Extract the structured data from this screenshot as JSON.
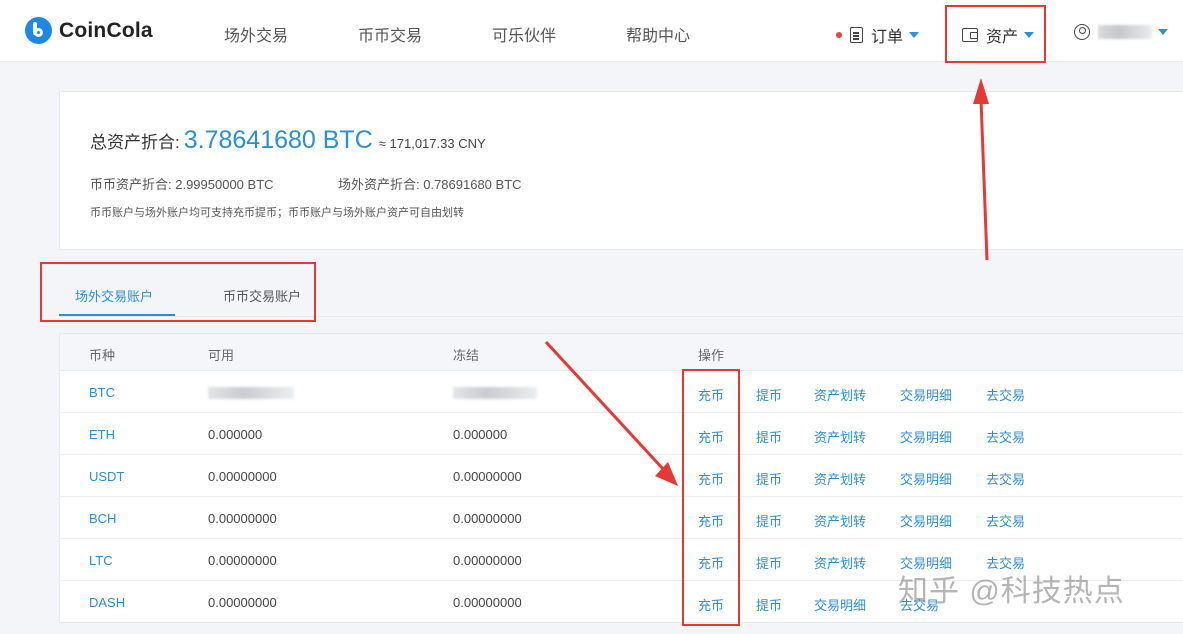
{
  "header": {
    "logo_text": "CoinCola",
    "nav": [
      "场外交易",
      "币币交易",
      "可乐伙伴",
      "帮助中心"
    ],
    "orders_label": "订单",
    "assets_label": "资产"
  },
  "summary": {
    "total_label": "总资产折合:",
    "total_value": "3.78641680 BTC",
    "total_cny": "≈ 171,017.33 CNY",
    "coin_assets": "币币资产折合: 2.99950000 BTC",
    "otc_assets": "场外资产折合: 0.78691680 BTC",
    "note": "币币账户与场外账户均可支持充币提币；币币账户与场外账户资产可自由划转"
  },
  "tabs": [
    "场外交易账户",
    "币币交易账户"
  ],
  "table": {
    "headers": [
      "币种",
      "可用",
      "冻结",
      "操作"
    ],
    "rows": [
      {
        "coin": "BTC",
        "available": "",
        "frozen": "",
        "actions": [
          "充币",
          "提币",
          "资产划转",
          "交易明细",
          "去交易"
        ]
      },
      {
        "coin": "ETH",
        "available": "0.000000",
        "frozen": "0.000000",
        "actions": [
          "充币",
          "提币",
          "资产划转",
          "交易明细",
          "去交易"
        ]
      },
      {
        "coin": "USDT",
        "available": "0.00000000",
        "frozen": "0.00000000",
        "actions": [
          "充币",
          "提币",
          "资产划转",
          "交易明细",
          "去交易"
        ]
      },
      {
        "coin": "BCH",
        "available": "0.00000000",
        "frozen": "0.00000000",
        "actions": [
          "充币",
          "提币",
          "资产划转",
          "交易明细",
          "去交易"
        ]
      },
      {
        "coin": "LTC",
        "available": "0.00000000",
        "frozen": "0.00000000",
        "actions": [
          "充币",
          "提币",
          "资产划转",
          "交易明细",
          "去交易"
        ]
      },
      {
        "coin": "DASH",
        "available": "0.00000000",
        "frozen": "0.00000000",
        "actions": [
          "充币",
          "提币",
          "交易明细",
          "去交易"
        ]
      }
    ]
  },
  "watermark": "知乎 @科技热点",
  "colors": {
    "accent": "#2c8fd6",
    "highlight": "#e53935"
  }
}
